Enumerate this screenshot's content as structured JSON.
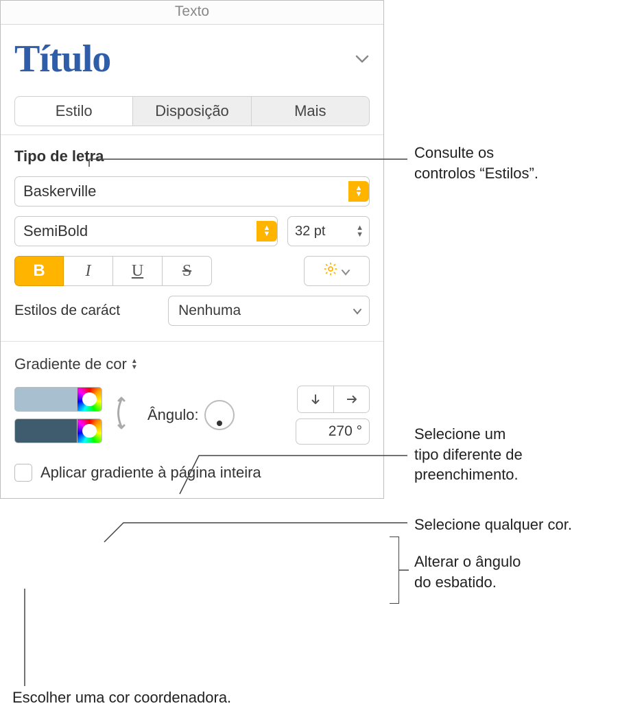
{
  "header": {
    "title": "Texto"
  },
  "style_picker": {
    "current": "Título"
  },
  "tabs": {
    "style": "Estilo",
    "layout": "Disposição",
    "more": "Mais"
  },
  "font": {
    "section_label": "Tipo de letra",
    "family": "Baskerville",
    "weight": "SemiBold",
    "size": "32 pt",
    "bold": "B",
    "italic": "I",
    "underline": "U",
    "strike": "S",
    "char_styles_label": "Estilos de caráct",
    "char_styles_value": "Nenhuma"
  },
  "gradient": {
    "label": "Gradiente de cor",
    "angle_label": "Ângulo:",
    "angle_value": "270 °",
    "apply_whole_page": "Aplicar gradiente à página inteira"
  },
  "callouts": {
    "c1": "Consulte os\ncontrolos “Estilos”.",
    "c2": "Selecione um\ntipo diferente de\npreenchimento.",
    "c3": "Selecione qualquer cor.",
    "c4": "Alterar o ângulo\ndo esbatido.",
    "c5": "Escolher uma cor coordenadora."
  }
}
